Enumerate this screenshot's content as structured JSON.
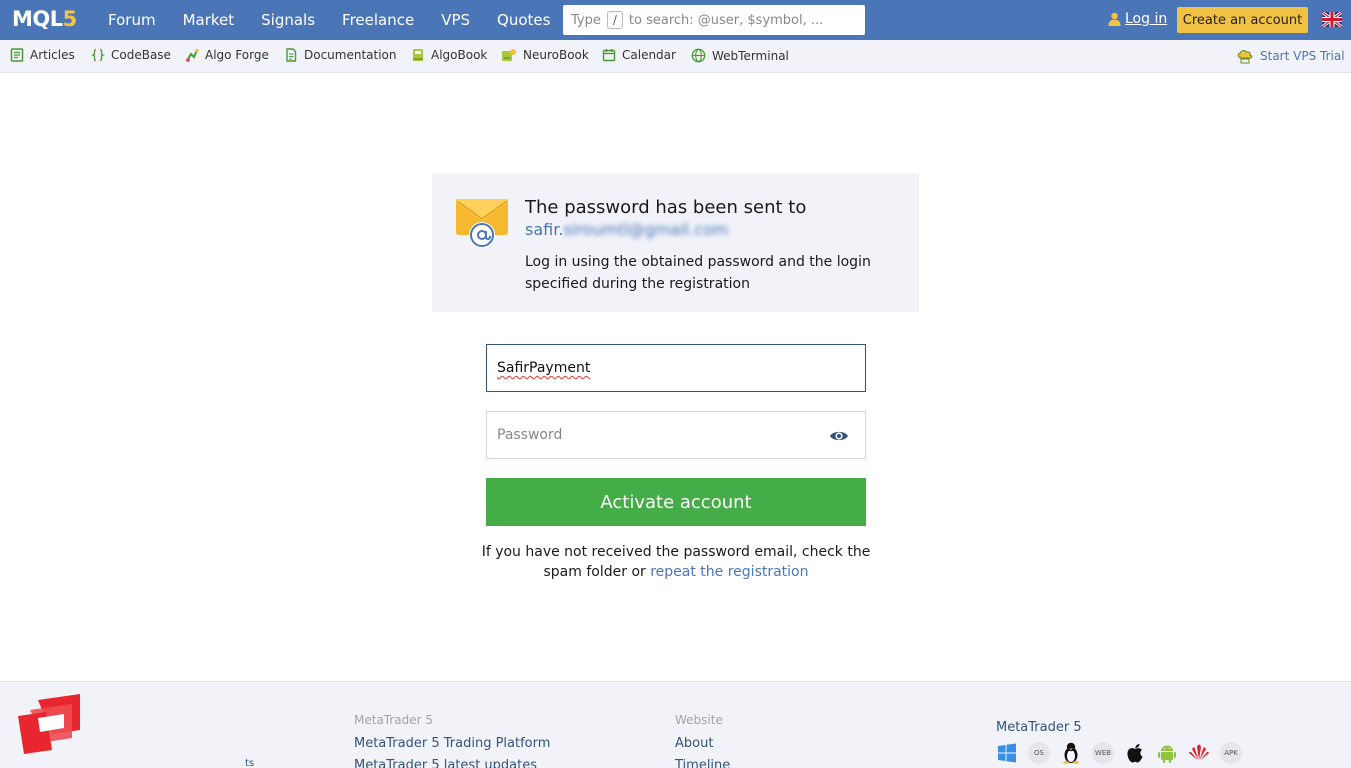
{
  "header": {
    "logo_main": "MQL",
    "logo_five": "5",
    "nav": [
      "Forum",
      "Market",
      "Signals",
      "Freelance",
      "VPS",
      "Quotes"
    ],
    "search": {
      "prefix": "Type",
      "key": "/",
      "suffix": "to search: @user, $symbol, ..."
    },
    "login_label": "Log in",
    "create_account_label": "Create an account",
    "colors": {
      "bar": "#4a76b8",
      "create_button": "#f0c142"
    }
  },
  "subnav": {
    "items": [
      {
        "label": "Articles",
        "icon": "articles-icon"
      },
      {
        "label": "CodeBase",
        "icon": "codebase-icon"
      },
      {
        "label": "Algo Forge",
        "icon": "algo-forge-icon"
      },
      {
        "label": "Documentation",
        "icon": "documentation-icon"
      },
      {
        "label": "AlgoBook",
        "icon": "algobook-icon"
      },
      {
        "label": "NeuroBook",
        "icon": "neurobook-icon"
      },
      {
        "label": "Calendar",
        "icon": "calendar-icon"
      },
      {
        "label": "WebTerminal",
        "icon": "webterminal-icon"
      }
    ],
    "vps_trial_label": "Start VPS Trial"
  },
  "notice": {
    "title": "The password has been sent to",
    "email_visible": "safir.",
    "email_blurred": "siroumtl@gmail.com",
    "description": "Log in using the obtained password and the login specified during the registration"
  },
  "form": {
    "login_value": "SafirPayment",
    "password_placeholder": "Password",
    "activate_label": "Activate account",
    "activate_color": "#44ad47",
    "help_text": "If you have not received the password email, check the spam folder or",
    "help_link": "repeat the registration"
  },
  "footer": {
    "col1_heading": "MetaTrader 5",
    "col1_links": [
      "MetaTrader 5 Trading Platform",
      "MetaTrader 5 latest updates"
    ],
    "col2_heading": "Website",
    "col2_links": [
      "About",
      "Timeline"
    ],
    "col3_title": "MetaTrader 5",
    "platform_icons": [
      "windows-icon",
      "macos-icon",
      "linux-icon",
      "web-icon",
      "apple-icon",
      "android-icon",
      "huawei-icon",
      "apk-icon"
    ],
    "platform_labels": {
      "macos": "OS",
      "web": "WEB",
      "apk": "APK"
    },
    "stray_text": "ts"
  }
}
